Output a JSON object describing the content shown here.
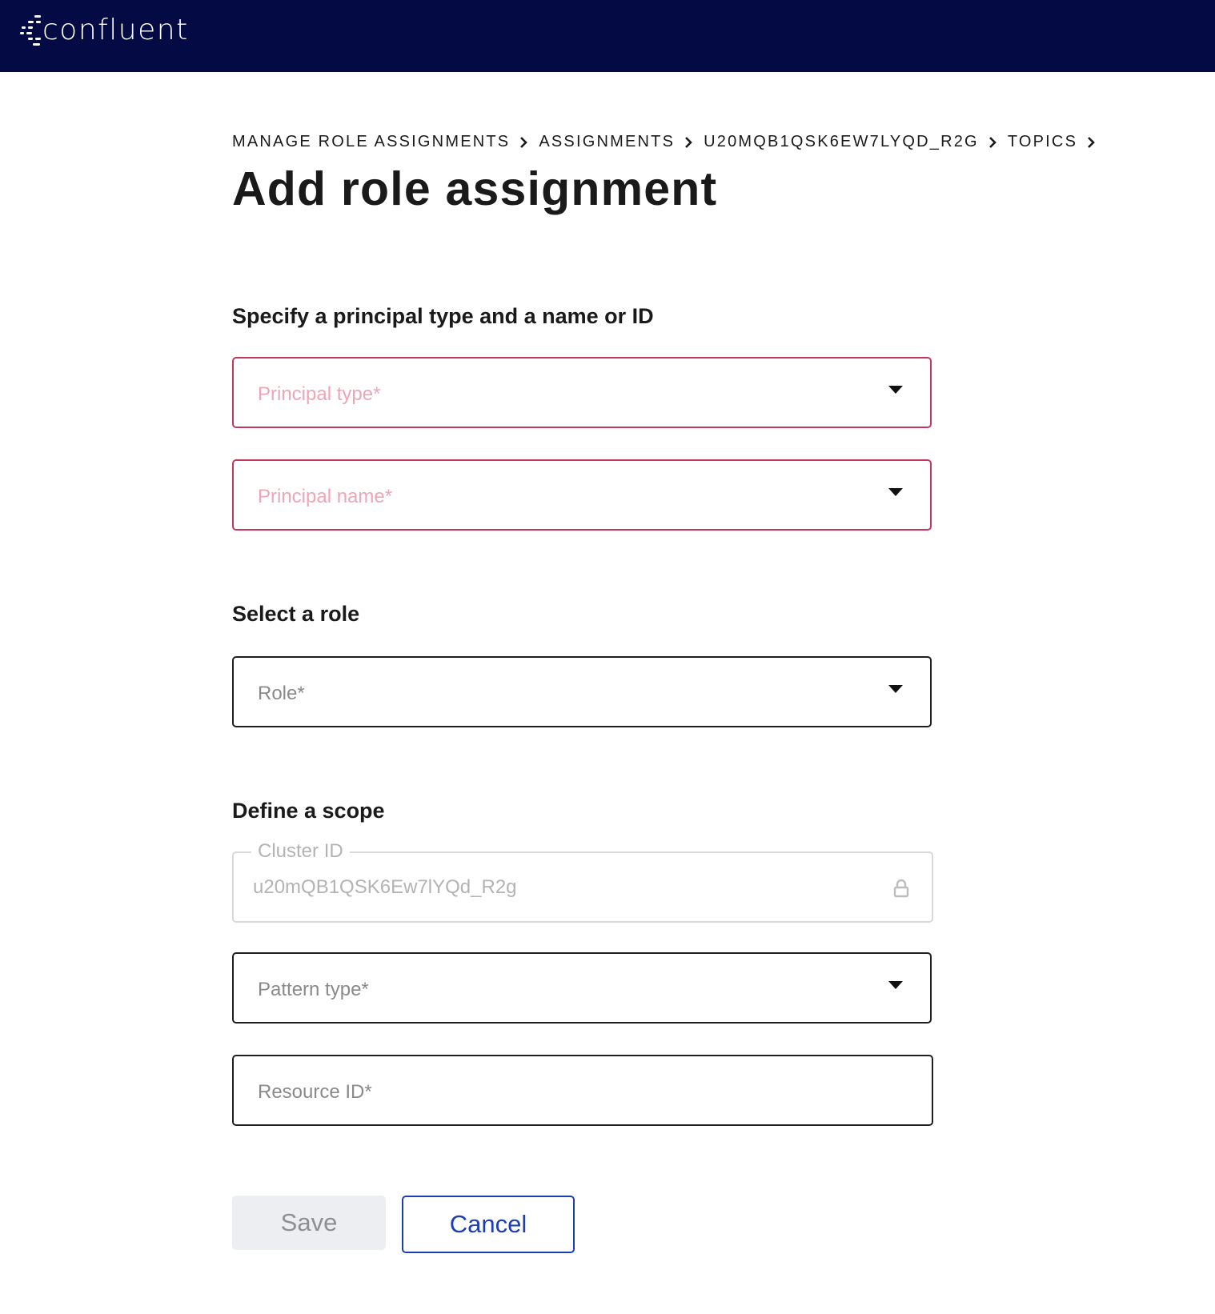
{
  "app": {
    "logo_text": "confluent"
  },
  "breadcrumb": [
    {
      "label": "MANAGE ROLE ASSIGNMENTS"
    },
    {
      "label": "ASSIGNMENTS"
    },
    {
      "label": "U20MQB1QSK6EW7LYQD_R2G"
    },
    {
      "label": "TOPICS"
    }
  ],
  "page": {
    "title": "Add role assignment"
  },
  "principal_section": {
    "title": "Specify a principal type and a name or ID",
    "principal_type_placeholder": "Principal type*",
    "principal_name_placeholder": "Principal name*"
  },
  "role_section": {
    "title": "Select a role",
    "role_placeholder": "Role*"
  },
  "scope_section": {
    "title": "Define a scope",
    "cluster_id_label": "Cluster ID",
    "cluster_id_value": "u20mQB1QSK6Ew7lYQd_R2g",
    "pattern_type_placeholder": "Pattern type*",
    "resource_id_placeholder": "Resource ID*"
  },
  "actions": {
    "save_label": "Save",
    "cancel_label": "Cancel"
  },
  "colors": {
    "topbar_bg": "#040b44",
    "error_border": "#c4375d",
    "error_placeholder": "#eba6b8",
    "primary_blue": "#1b3eb4",
    "disabled_bg": "#eceef2"
  },
  "icons": {
    "logo": "confluent-logo-icon",
    "breadcrumb_separator": "chevron-right-icon",
    "dropdown": "caret-down-icon",
    "locked": "lock-icon"
  }
}
